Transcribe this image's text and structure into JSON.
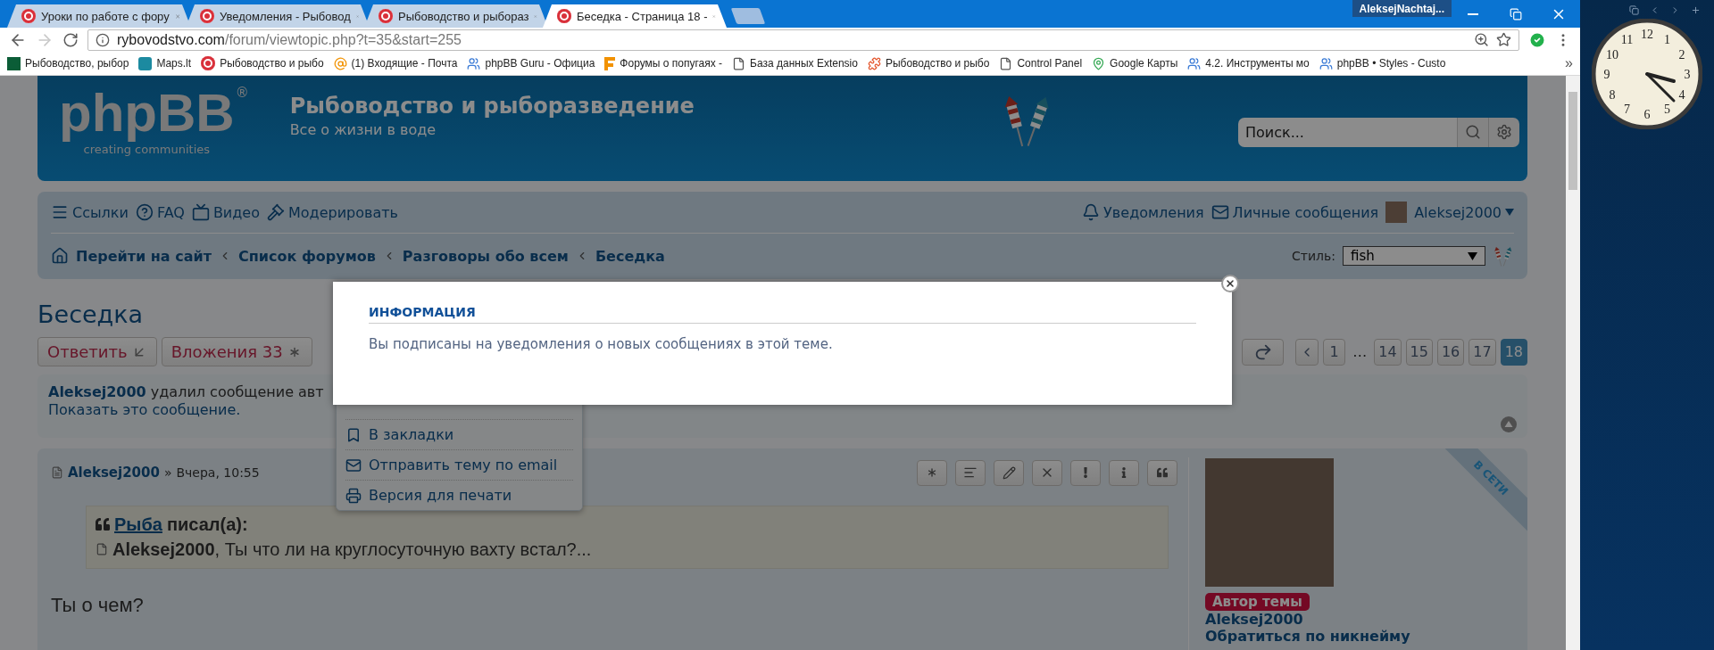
{
  "browser": {
    "tabs": [
      {
        "title": "Уроки по работе с фору",
        "selected": false
      },
      {
        "title": "Уведомления - Рыбовод",
        "selected": false
      },
      {
        "title": "Рыбоводство и рыбораз",
        "selected": false
      },
      {
        "title": "Беседка - Страница 18 -",
        "selected": true
      }
    ],
    "profile": "AleksejNachtaj...",
    "url": {
      "host": "rybovodstvo.com",
      "path": "/forum/viewtopic.php?t=35&start=255"
    },
    "bookmarks": [
      {
        "kind": "square",
        "title": "Рыбоводство, рыбор"
      },
      {
        "kind": "tile",
        "title": "Maps.lt"
      },
      {
        "kind": "circle",
        "title": "Рыбоводство и рыбо"
      },
      {
        "kind": "mail",
        "title": "(1) Входящие - Почта"
      },
      {
        "kind": "people",
        "title": "phpBB Guru - Официа"
      },
      {
        "kind": "flag",
        "title": "Форумы о попугаях -"
      },
      {
        "kind": "page",
        "title": "База данных Extensio"
      },
      {
        "kind": "puzzle",
        "title": "Рыбоводство и рыбо"
      },
      {
        "kind": "page",
        "title": "Control Panel"
      },
      {
        "kind": "pin",
        "title": "Google Карты"
      },
      {
        "kind": "people",
        "title": "4.2. Инструменты мо"
      },
      {
        "kind": "people",
        "title": "phpBB • Styles - Custo"
      }
    ],
    "bookmarks_more": "»"
  },
  "forum": {
    "logo": {
      "wordmark": "phpBB",
      "mark": "®",
      "tagline": "creating communities"
    },
    "site_title": "Рыбоводство и рыборазведение",
    "site_description": "Все о жизни в воде",
    "search": {
      "placeholder": "Поиск..."
    },
    "quick_links": [
      {
        "kind": "menu",
        "label": "Ссылки"
      },
      {
        "kind": "help",
        "label": "FAQ"
      },
      {
        "kind": "video",
        "label": "Видео"
      },
      {
        "kind": "moderate",
        "label": "Модерировать"
      }
    ],
    "user_links": [
      {
        "kind": "bell",
        "label": "Уведомления"
      },
      {
        "kind": "mail",
        "label": "Личные сообщения"
      }
    ],
    "username": "Aleksej2000",
    "breadcrumbs": [
      "Перейти на сайт",
      "Список форумов",
      "Разговоры обо всем",
      "Беседка"
    ],
    "style": {
      "label": "Стиль:",
      "value": "fish"
    },
    "topic_title": "Беседка",
    "actions": [
      {
        "kind": "reply",
        "label": "Ответить"
      },
      {
        "kind": "attachments",
        "label": "Вложения 33"
      }
    ],
    "pages": [
      {
        "kind": "page",
        "label": "1",
        "selected": false
      },
      {
        "kind": "gap",
        "label": "…",
        "selected": false
      },
      {
        "kind": "page",
        "label": "14",
        "selected": false
      },
      {
        "kind": "page",
        "label": "15",
        "selected": false
      },
      {
        "kind": "page",
        "label": "16",
        "selected": false
      },
      {
        "kind": "page",
        "label": "17",
        "selected": false
      },
      {
        "kind": "page",
        "label": "18",
        "selected": true
      }
    ],
    "notice": {
      "text": "**Aleksej2000** удалил сообщение авт",
      "link": "Показать это сообщение."
    },
    "topic_tools": [
      {
        "kind": "bookmark",
        "label": "В закладки"
      },
      {
        "kind": "mail",
        "label": "Отправить тему по email"
      },
      {
        "kind": "print",
        "label": "Версия для печати"
      }
    ],
    "post": {
      "author": "Aleksej2000",
      "separator": "»",
      "time": "Вчера, 10:55",
      "buttons": [
        {
          "kind": "star"
        },
        {
          "kind": "lines"
        },
        {
          "kind": "edit"
        },
        {
          "kind": "delete"
        },
        {
          "kind": "report"
        },
        {
          "kind": "info"
        },
        {
          "kind": "quote"
        }
      ],
      "quote": {
        "author": "Рыба",
        "says": "писал(а):",
        "text": "**Aleksej2000**, Ты что ли на круглосуточную вахту встал?..."
      },
      "body": "Ты о чем?",
      "online": "В СЕТИ",
      "rank": "Автор темы",
      "profile_name": "Aleksej2000",
      "mention": "Обратиться по никнейму"
    }
  },
  "modal": {
    "title": "ИНФОРМАЦИЯ",
    "message": "Вы подписаны на уведомления о новых сообщениях в этой теме."
  },
  "desktop": {
    "clock_numerals": [
      "12",
      "1",
      "2",
      "3",
      "4",
      "5",
      "6",
      "7",
      "8",
      "9",
      "10",
      "11"
    ]
  }
}
